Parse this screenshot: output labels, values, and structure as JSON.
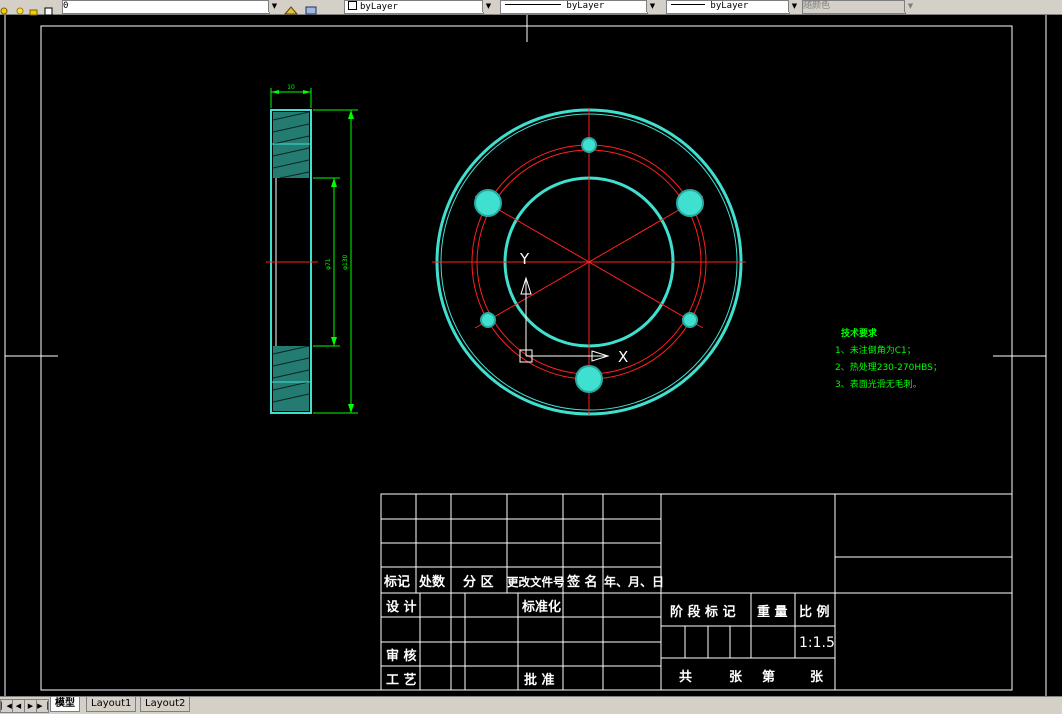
{
  "toolbar": {
    "layer_value": "0",
    "color_value": "byLayer",
    "linetype_value": "byLayer",
    "lineweight_value": "byLayer",
    "plotstyle_value": "随颜色"
  },
  "tabs": [
    {
      "label": "模型",
      "active": true
    },
    {
      "label": "Layout1",
      "active": false
    },
    {
      "label": "Layout2",
      "active": false
    }
  ],
  "drawing": {
    "dim_thickness": "10",
    "dim_inner": "φ71",
    "dim_outer": "φ130",
    "ucs_y": "Y",
    "ucs_x": "X",
    "tech_title": "技术要求",
    "tech_notes": [
      "1、未注倒角为C1；",
      "2、热处理230-270HBS；",
      "3、表面光滑无毛刺。"
    ]
  },
  "title_block": {
    "rev_headers": [
      "标记",
      "处数",
      "分 区",
      "更改文件号",
      "签 名",
      "年、月、日"
    ],
    "design": "设 计",
    "standardize": "标准化",
    "review": "审 核",
    "process": "工 艺",
    "approve": "批 准",
    "stage_mark": "阶 段 标 记",
    "weight": "重 量",
    "scale_label": "比 例",
    "scale_value": "1:1.5",
    "total": "共",
    "sheets": "张",
    "sheet_no": "第",
    "sheet_end": "张"
  },
  "colors": {
    "background": "#000000",
    "frame": "#ffffff",
    "part_outline": "#40e0d0",
    "center_lines": "#ff2020",
    "dimensions": "#00ff00",
    "tech_notes": "#00ff00"
  }
}
